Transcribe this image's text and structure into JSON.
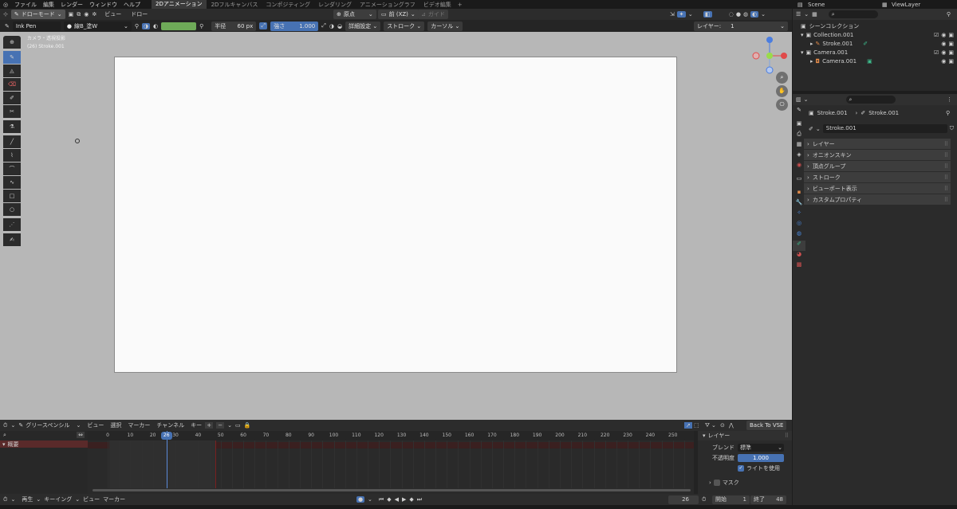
{
  "topbar": {
    "menus": [
      "ファイル",
      "編集",
      "レンダー",
      "ウィンドウ",
      "ヘルプ"
    ],
    "workspaces": [
      "2Dアニメーション",
      "2Dフルキャンバス",
      "コンポジティング",
      "レンダリング",
      "アニメーショングラフ",
      "ビデオ編集",
      "+"
    ],
    "active_workspace": "2Dアニメーション",
    "scene": "Scene",
    "view_layer": "ViewLayer"
  },
  "viewport_header": {
    "mode": "ドローモード",
    "menus": [
      "ビュー",
      "ドロー"
    ],
    "origin": "原点",
    "view_plane": "前 (XZ)",
    "guide": "ガイド"
  },
  "tool_settings": {
    "brush": "Ink Pen",
    "material": "線B_塗W",
    "radius_label": "半径",
    "radius_value": "60 px",
    "strength_label": "強さ",
    "strength_value": "1.000",
    "advanced": "詳細設定",
    "stroke": "ストローク",
    "cursor": "カーソル",
    "layer_label": "レイヤー:",
    "layer_value": "1"
  },
  "viewport": {
    "info_line1": "カメラ・透視投影",
    "info_line2": "(26) Stroke.001",
    "canvas_color": "#fafafa",
    "bg_color": "#b7b7b7"
  },
  "outliner": {
    "title": "シーンコレクション",
    "items": [
      {
        "label": "Collection.001",
        "indent": 0
      },
      {
        "label": "Stroke.001",
        "indent": 1
      },
      {
        "label": "Camera.001",
        "indent": 0
      },
      {
        "label": "Camera.001",
        "indent": 1
      }
    ]
  },
  "properties": {
    "breadcrumb_a": "Stroke.001",
    "breadcrumb_b": "Stroke.001",
    "data_name": "Stroke.001",
    "panels": [
      "レイヤー",
      "オニオンスキン",
      "頂点グループ",
      "ストローク",
      "ビューポート表示",
      "カスタムプロパティ"
    ]
  },
  "dopesheet": {
    "mode": "グリースペンシル",
    "menus": [
      "ビュー",
      "選択",
      "マーカー",
      "チャンネル",
      "キー"
    ],
    "back_to_vse": "Back To VSE",
    "current_frame": "26",
    "ticks": [
      "0",
      "10",
      "20",
      "30",
      "40",
      "50",
      "60",
      "70",
      "80",
      "90",
      "100",
      "110",
      "120",
      "130",
      "140",
      "150",
      "160",
      "170",
      "180",
      "190",
      "200",
      "210",
      "220",
      "230",
      "240",
      "250"
    ],
    "channel": "概要",
    "layer_panel": {
      "title": "レイヤー",
      "blend_label": "ブレンド",
      "blend_value": "標準",
      "opacity_label": "不透明度",
      "opacity_value": "1.000",
      "use_lights": "ライトを使用",
      "mask": "マスク"
    }
  },
  "timeline_footer": {
    "menus": [
      "再生",
      "キーイング",
      "ビュー",
      "マーカー"
    ],
    "frame": "26",
    "start_label": "開始",
    "start_value": "1",
    "end_label": "終了",
    "end_value": "48"
  }
}
